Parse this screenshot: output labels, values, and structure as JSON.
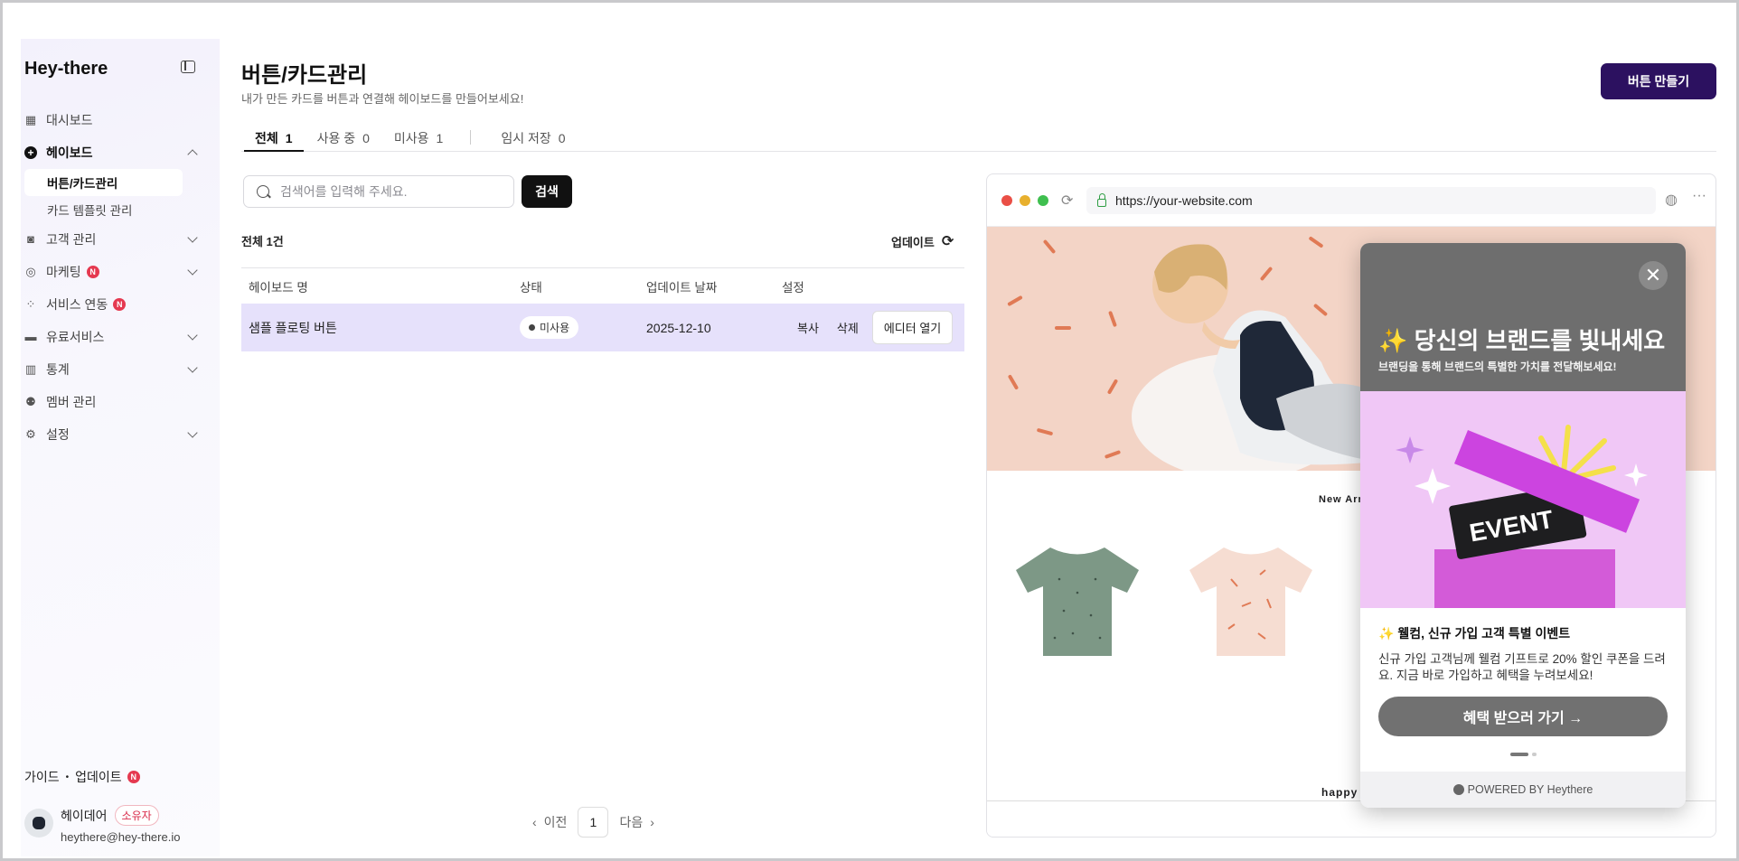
{
  "sidebar": {
    "logo": "Hey-there",
    "items": [
      {
        "label": "대시보드"
      },
      {
        "label": "헤이보드"
      },
      {
        "label": "고객 관리"
      },
      {
        "label": "마케팅",
        "badge": "N"
      },
      {
        "label": "서비스 연동",
        "badge": "N"
      },
      {
        "label": "유료서비스"
      },
      {
        "label": "통계"
      },
      {
        "label": "멤버 관리"
      },
      {
        "label": "설정"
      }
    ],
    "subitems": [
      {
        "label": "버튼/카드관리"
      },
      {
        "label": "카드 템플릿 관리"
      }
    ],
    "guide": "가이드",
    "update": "업데이트",
    "update_badge": "N",
    "user": {
      "name": "헤이데어",
      "role": "소유자",
      "email": "heythere@hey-there.io"
    }
  },
  "header": {
    "title": "버튼/카드관리",
    "subtitle": "내가 만든 카드를 버튼과 연결해 헤이보드를 만들어보세요!",
    "create_button": "버튼 만들기"
  },
  "tabs": [
    {
      "label": "전체",
      "count": "1"
    },
    {
      "label": "사용 중",
      "count": "0"
    },
    {
      "label": "미사용",
      "count": "1"
    },
    {
      "label": "임시 저장",
      "count": "0"
    }
  ],
  "search": {
    "placeholder": "검색어를 입력해 주세요.",
    "button": "검색"
  },
  "list": {
    "total": "전체 1건",
    "update_label": "업데이트",
    "columns": [
      "헤이보드 명",
      "상태",
      "업데이트 날짜",
      "설정"
    ],
    "rows": [
      {
        "name": "샘플 플로팅 버튼",
        "status": "미사용",
        "date": "2025-12-10",
        "copy": "복사",
        "delete": "삭제",
        "open": "에디터 열기"
      }
    ]
  },
  "pagination": {
    "prev": "이전",
    "page": "1",
    "next": "다음"
  },
  "preview": {
    "url": "https://your-website.com",
    "shop_heading": "New Arr",
    "shop_footer_text": "happy",
    "popup": {
      "close": "✕",
      "title": "✨ 당신의 브랜드를 빛내세요",
      "subtitle": "브랜딩을 통해 브랜드의 특별한 가치를 전달해보세요!",
      "image_text": "EVENT",
      "body_title": "✨ 웰컴, 신규 가입 고객 특별 이벤트",
      "body_text": "신규 가입 고객님께 웰컴 기프트로 20% 할인 쿠폰을 드려요. 지금 바로 가입하고 혜택을 누려보세요!",
      "cta": "혜택 받으러 가기 →",
      "powered": "POWERED BY Heythere"
    }
  },
  "colors": {
    "brand": "#2c1160",
    "row_highlight": "#e6e1fb",
    "badge": "#e53950"
  }
}
